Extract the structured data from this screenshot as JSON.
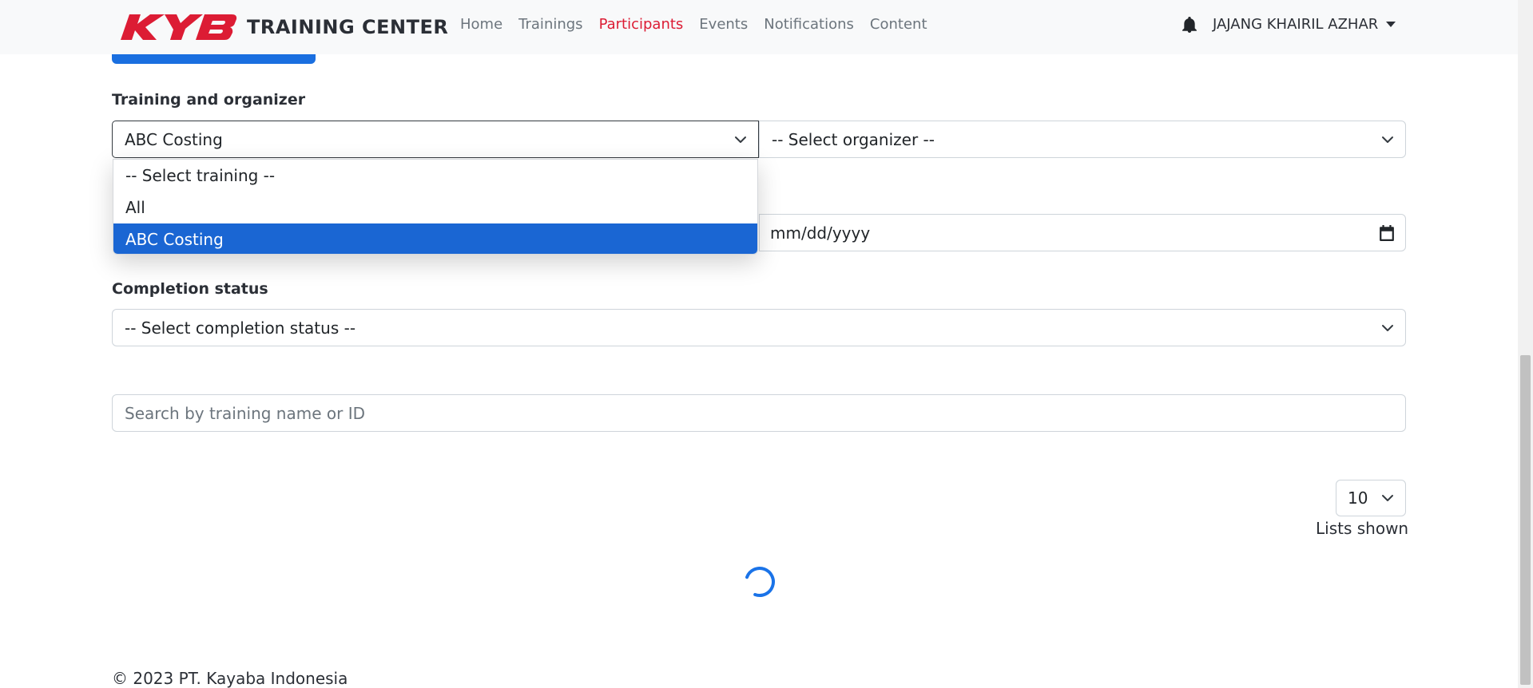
{
  "navbar": {
    "brand_logo": "KYB",
    "brand_text": "TRAINING CENTER",
    "links": [
      "Home",
      "Trainings",
      "Participants",
      "Events",
      "Notifications",
      "Content"
    ],
    "active_link": "Participants",
    "user_name": "JAJANG KHAIRIL AZHAR"
  },
  "filters": {
    "training_label": "Training and organizer",
    "training_value": "ABC Costing",
    "organizer_value": "-- Select organizer --",
    "training_options": [
      "-- Select training --",
      "All",
      "ABC Costing"
    ],
    "selected_option": "ABC Costing",
    "date_placeholder": "mm/dd/yyyy",
    "completion_label": "Completion status",
    "completion_value": "-- Select completion status --",
    "search_placeholder": "Search by training name or ID"
  },
  "pagination": {
    "per_page": "10",
    "lists_shown_label": "Lists shown"
  },
  "footer": {
    "copyright": "© 2023 PT. Kayaba Indonesia"
  },
  "colors": {
    "brand_red": "#dc1c34",
    "primary_blue": "#1a66d3",
    "spinner_blue": "#1a73e8"
  }
}
